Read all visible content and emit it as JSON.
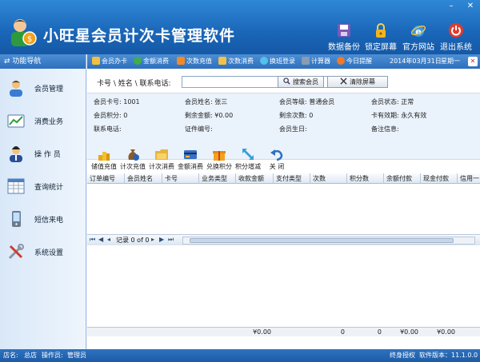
{
  "app": {
    "title": "小旺星会员计次卡管理软件"
  },
  "window_controls": {
    "minimize": "–",
    "close": "✕"
  },
  "header_buttons": [
    {
      "label": "数据备份",
      "icon": "floppy-disk-icon"
    },
    {
      "label": "锁定屏幕",
      "icon": "padlock-icon"
    },
    {
      "label": "官方网站",
      "icon": "ie-browser-icon"
    },
    {
      "label": "退出系统",
      "icon": "power-icon"
    }
  ],
  "sidebar": {
    "header": "功能导航",
    "items": [
      {
        "label": "会员管理",
        "icon": "member-icon"
      },
      {
        "label": "消费业务",
        "icon": "consumption-icon"
      },
      {
        "label": "操 作 员",
        "icon": "operator-icon"
      },
      {
        "label": "查询统计",
        "icon": "statistics-icon"
      },
      {
        "label": "短信来电",
        "icon": "phone-sms-icon"
      },
      {
        "label": "系统设置",
        "icon": "settings-tools-icon"
      }
    ]
  },
  "toolbar": {
    "items": [
      {
        "label": "会员办卡",
        "icon": "card-icon"
      },
      {
        "label": "金额消费",
        "icon": "coin-icon"
      },
      {
        "label": "次数充值",
        "icon": "recharge-icon"
      },
      {
        "label": "次数消费",
        "icon": "count-consume-icon"
      },
      {
        "label": "换班登录",
        "icon": "shift-login-icon"
      },
      {
        "label": "计算器",
        "icon": "calculator-icon"
      },
      {
        "label": "今日提醒",
        "icon": "alarm-icon"
      }
    ],
    "date": "2014年03月31日",
    "weekday": "星期一",
    "close": "✕"
  },
  "search": {
    "label": "卡号 \\ 姓名 \\ 联系电话:",
    "value": "",
    "search_button": "搜索会员",
    "clear_button": "清除屏幕"
  },
  "member": {
    "card_no_label": "会员卡号:",
    "card_no": "1001",
    "name_label": "会员姓名:",
    "name": "张三",
    "level_label": "会员等级:",
    "level": "普通会员",
    "status_label": "会员状态:",
    "status": "正常",
    "points_label": "会员积分:",
    "points": "0",
    "balance_label": "剩余金额:",
    "balance": "¥0.00",
    "remaining_label": "剩余次数:",
    "remaining": "0",
    "validity_label": "卡有效期:",
    "validity": "永久有效",
    "phone_label": "联系电话:",
    "phone": "",
    "id_label": "证件编号:",
    "id": "",
    "birthday_label": "会员生日:",
    "birthday": "",
    "note_label": "备注信息:",
    "note": ""
  },
  "actions": [
    {
      "label": "储值充值",
      "icon": "coin-stack-icon"
    },
    {
      "label": "计次充值",
      "icon": "money-bag-icon"
    },
    {
      "label": "计次消费",
      "icon": "folder-icon"
    },
    {
      "label": "金额消费",
      "icon": "credit-card-icon"
    },
    {
      "label": "兑换积分",
      "icon": "gift-icon"
    },
    {
      "label": "积分增减",
      "icon": "resize-arrows-icon"
    },
    {
      "label": "关 闭",
      "icon": "undo-arrow-icon"
    }
  ],
  "table": {
    "columns": [
      "订单编号",
      "会员姓名",
      "卡号",
      "业务类型",
      "收款金额",
      "支付类型",
      "次数",
      "积分数",
      "余额付款",
      "现金付款",
      "信用一"
    ],
    "rows": [],
    "totals": {
      "amount": "¥0.00",
      "count": "0",
      "points": "0",
      "balance_pay": "¥0.00",
      "cash_pay": "¥0.00"
    }
  },
  "pager": {
    "text": "记录 0 of 0"
  },
  "status_bar": {
    "store_label": "店名:",
    "store": "总店",
    "operator_label": "操作员:",
    "operator": "管理员",
    "license": "终身授权",
    "version": "软件版本：11.1.0.0"
  }
}
